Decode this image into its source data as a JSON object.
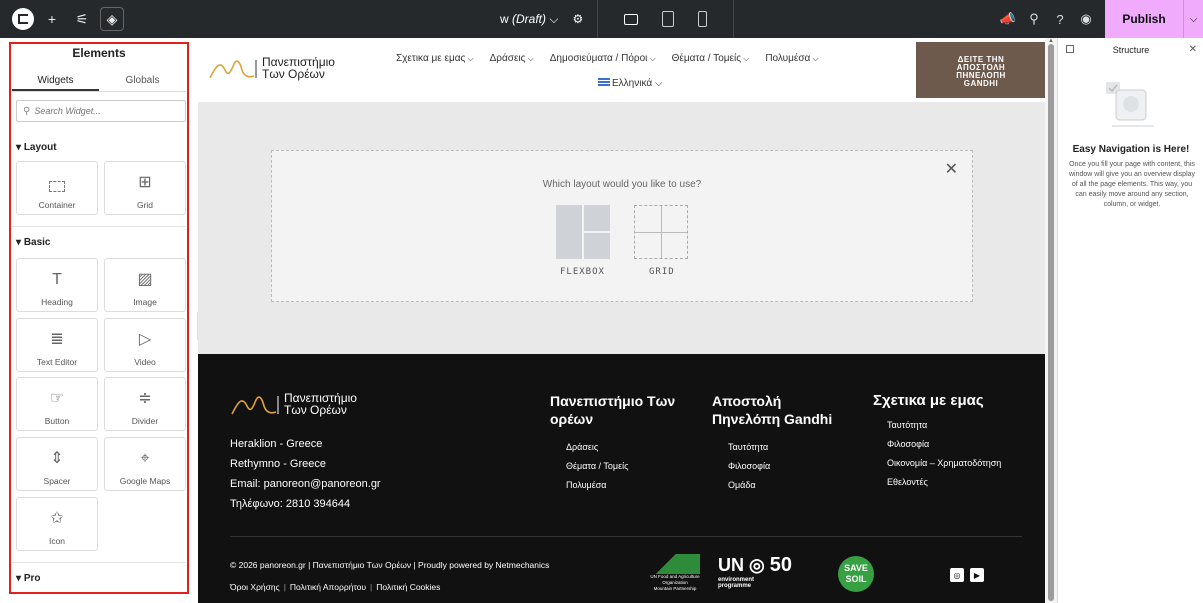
{
  "topbar": {
    "doc_name": "w",
    "doc_status": "(Draft)",
    "publish_label": "Publish"
  },
  "panel": {
    "title": "Elements",
    "tabs": [
      "Widgets",
      "Globals"
    ],
    "search_placeholder": "Search Widget...",
    "categories": {
      "layout": "Layout",
      "basic": "Basic",
      "pro": "Pro"
    },
    "widgets": {
      "container": "Container",
      "grid": "Grid",
      "heading": "Heading",
      "image": "Image",
      "text_editor": "Text Editor",
      "video": "Video",
      "button": "Button",
      "divider": "Divider",
      "spacer": "Spacer",
      "google_maps": "Google Maps",
      "icon": "Icon"
    }
  },
  "site": {
    "logo_line1": "Πανεπιστήμιο",
    "logo_line2": "Των Ορέων",
    "nav": [
      "Σχετικα με εμας",
      "Δράσεις",
      "Δημοσιεύματα / Πόροι",
      "Θέματα / Τομείς",
      "Πολυμέσα"
    ],
    "language": "Ελληνικά",
    "banner_lines": [
      "ΔΕΙΤΕ ΤΗΝ",
      "ΑΠΟΣΤΟΛΗ",
      "ΠΗΝΕΛΟΠΗ",
      "GANDHI"
    ]
  },
  "layout_picker": {
    "question": "Which layout would you like to use?",
    "flexbox": "FLEXBOX",
    "grid": "GRID"
  },
  "footer": {
    "contact": [
      "Heraklion - Greece",
      "Rethymno - Greece",
      "Email: panoreon@panoreon.gr",
      "Τηλέφωνο: 2810 394644"
    ],
    "col1": {
      "title_1": "Πανεπιστήμιο Των",
      "title_2": "ορέων",
      "items": [
        "Δράσεις",
        "Θέματα / Τομείς",
        "Πολυμέσα"
      ]
    },
    "col2": {
      "title_1": "Αποστολή",
      "title_2": "Πηνελόπη Gandhi",
      "items": [
        "Ταυτότητα",
        "Φιλοσοφία",
        "Ομάδα"
      ]
    },
    "col3": {
      "title_1": "Σχετικα με εμας",
      "items": [
        "Ταυτότητα",
        "Φιλοσοφία",
        "Οικονομία – Χρηματοδότηση",
        "Εθελοντές"
      ]
    },
    "copyright": "© 2026 panoreon.gr | Πανεπιστήμιο Των Ορέων | Proudly powered by Netmechanics",
    "links": [
      "Όροι Χρήσης",
      "Πολιτική Απορρήτου",
      "Πολιτική Cookies"
    ],
    "fao_text_1": "UN Food and Agriculture Organization",
    "fao_text_2": "Mountain Partnership",
    "unep_1": "UN",
    "unep_2": "environment",
    "unep_3": "programme",
    "unep_50": "50",
    "soil_1": "SAVE",
    "soil_2": "SOIL"
  },
  "structure": {
    "title": "Structure",
    "heading": "Easy Navigation is Here!",
    "text": "Once you fill your page with content, this window will give you an overview display of all the page elements. This way, you can easily move around any section, column, or widget."
  },
  "colors": {
    "publish": "#f0abfc",
    "highlight": "#e0201b",
    "banner": "#6e5a4c",
    "footer": "#111111"
  }
}
